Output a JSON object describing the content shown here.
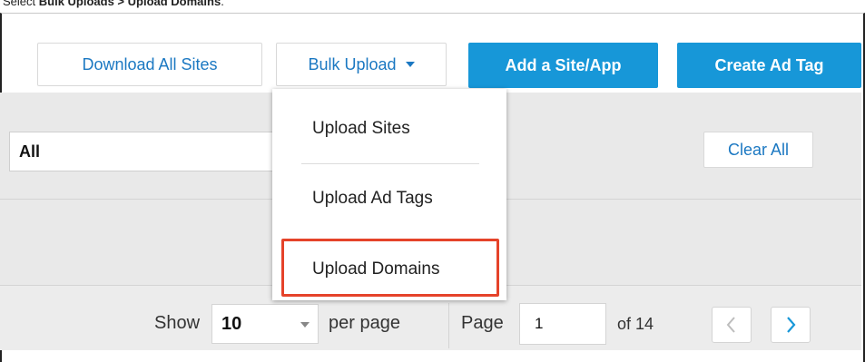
{
  "caption": {
    "prefix": "Select ",
    "emphasis": "Bulk Uploads > Upload Domains",
    "suffix": "."
  },
  "toolbar": {
    "download_all_sites": "Download All Sites",
    "bulk_upload": "Bulk Upload",
    "add_site_app": "Add a Site/App",
    "create_ad_tag": "Create Ad Tag"
  },
  "bulk_upload_menu": {
    "items": [
      "Upload Sites",
      "Upload Ad Tags",
      "Upload Domains"
    ],
    "highlighted": "Upload Domains"
  },
  "filters": {
    "status_value": "All",
    "clear_all": "Clear All"
  },
  "pagination": {
    "show_label": "Show",
    "per_page_value": "10",
    "per_page_label": "per page",
    "page_label": "Page",
    "current_page": "1",
    "of_label": "of 14"
  },
  "colors": {
    "primary": "#1797d8",
    "link": "#1b78c2",
    "highlight": "#e5432a"
  }
}
